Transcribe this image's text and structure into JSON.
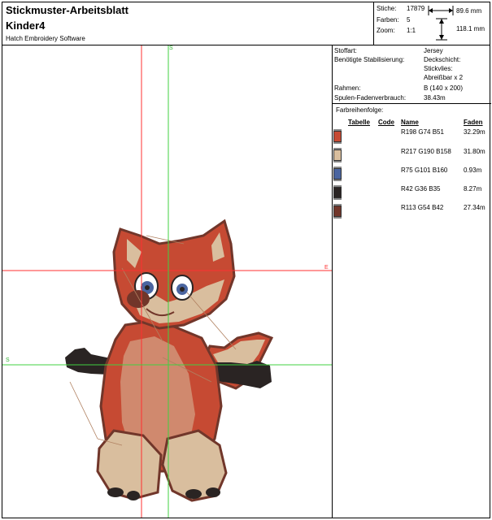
{
  "header": {
    "title": "Stickmuster-Arbeitsblatt",
    "design_name": "Kinder4",
    "software": "Hatch Embroidery Software"
  },
  "stats": {
    "stitches_label": "Stiche:",
    "stitches_value": "17879",
    "colors_label": "Farben:",
    "colors_value": "5",
    "zoom_label": "Zoom:",
    "zoom_value": "1:1",
    "width": "89.6 mm",
    "height": "118.1 mm"
  },
  "details": {
    "fabric_label": "Stoffart:",
    "fabric_value": "Jersey",
    "stabilizer_label": "Benötigte Stabilisierung:",
    "stabilizer_top": "Deckschicht:",
    "stabilizer_bottom": "Stickvlies:",
    "stabilizer_detail": "Abreißbar x 2",
    "hoop_label": "Rahmen:",
    "hoop_value": "B (140 x 200)",
    "bobbin_label": "Spulen-Fadenverbrauch:",
    "bobbin_value": "38.43m"
  },
  "sequence": {
    "title": "Farbreihenfolge:",
    "col_table": "Tabelle",
    "col_code": "Code",
    "col_name": "Name",
    "col_thread": "Faden",
    "colors": [
      {
        "swatch": "#c64a33",
        "name": "R198 G74 B51",
        "length": "32.29m"
      },
      {
        "swatch": "#d9be9e",
        "name": "R217 G190 B158",
        "length": "31.80m"
      },
      {
        "swatch": "#4b65a0",
        "name": "R75 G101 B160",
        "length": "0.93m"
      },
      {
        "swatch": "#2a2423",
        "name": "R42 G36 B35",
        "length": "8.27m"
      },
      {
        "swatch": "#71362a",
        "name": "R113 G54 B42",
        "length": "27.34m"
      }
    ]
  },
  "axes": {
    "s_top": "S",
    "s_left": "S",
    "e_right": "E"
  }
}
